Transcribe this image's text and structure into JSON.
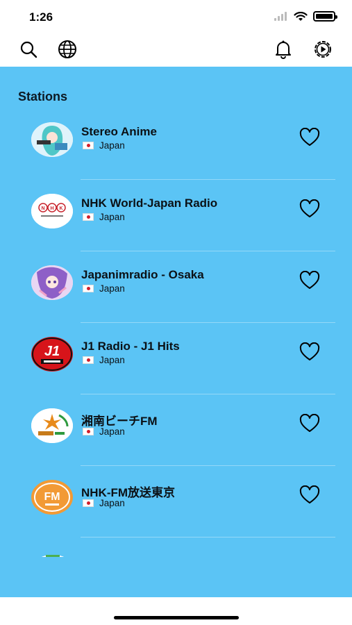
{
  "status_bar": {
    "time": "1:26"
  },
  "toolbar": {
    "left_icons": [
      "search-icon",
      "globe-icon"
    ],
    "right_icons": [
      "bell-icon",
      "settings-play-icon"
    ]
  },
  "section": {
    "title": "Stations"
  },
  "stations": [
    {
      "name": "Stereo Anime",
      "country": "Japan",
      "logo": "anime-girl"
    },
    {
      "name": "NHK World-Japan Radio",
      "country": "Japan",
      "logo": "nhk"
    },
    {
      "name": "Japanimradio - Osaka",
      "country": "Japan",
      "logo": "anime-purple"
    },
    {
      "name": "J1 Radio - J1 Hits",
      "country": "Japan",
      "logo": "j1"
    },
    {
      "name": "湘南ビーチFM",
      "country": "Japan",
      "logo": "shonan"
    },
    {
      "name": "NHK-FM放送東京",
      "country": "Japan",
      "logo": "fm-orange"
    }
  ],
  "colors": {
    "content_bg": "#5bc4f5",
    "text": "#0b1116",
    "flag_red": "#d21e2b"
  }
}
